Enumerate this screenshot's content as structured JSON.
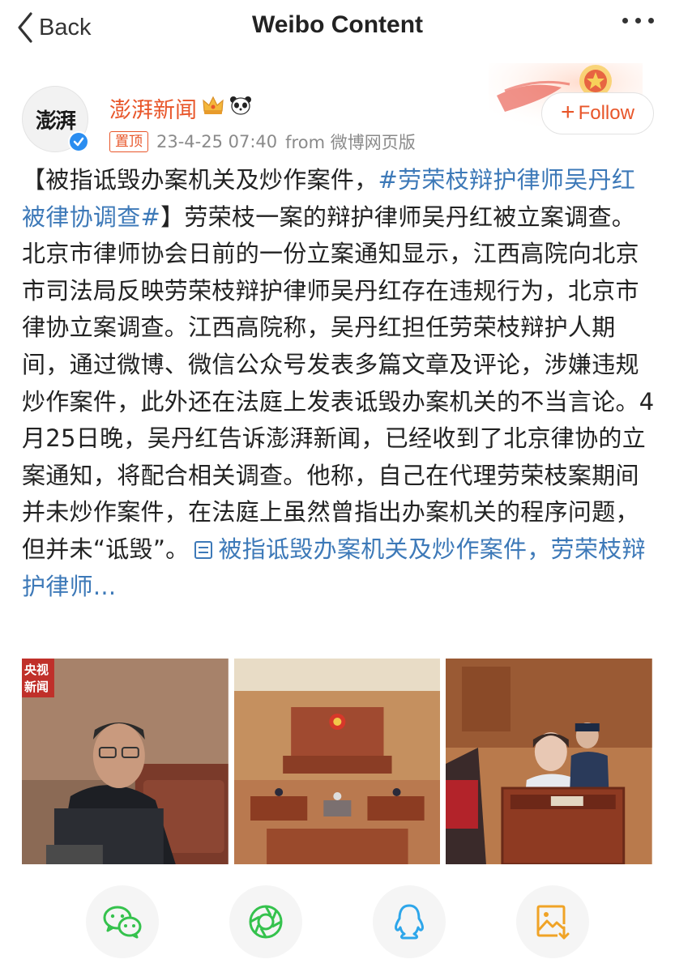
{
  "nav": {
    "back_label": "Back",
    "title": "Weibo Content"
  },
  "post": {
    "username": "澎湃新闻",
    "avatar_text": "澎湃",
    "pinned_badge": "置顶",
    "timestamp": "23-4-25 07:40",
    "source": "from 微博网页版",
    "follow_label": "Follow",
    "text_part1": "【被指诋毁办案机关及炒作案件，",
    "hashtag": "#劳荣枝辩护律师吴丹红被律协调查#",
    "text_part2": "】劳荣枝一案的辩护律师吴丹红被立案调查。北京市律师协会日前的一份立案通知显示，江西高院向北京市司法局反映劳荣枝辩护律师吴丹红存在违规行为，北京市律协立案调查。江西高院称，吴丹红担任劳荣枝辩护人期间，通过微博、微信公众号发表多篇文章及评论，涉嫌违规炒作案件，此外还在法庭上发表诋毁办案机关的不当言论。4月25日晚，吴丹红告诉澎湃新闻，已经收到了北京律协的立案通知，将配合相关调查。他称，自己在代理劳荣枝案期间并未炒作案件，在法庭上虽然曾指出办案机关的程序问题，但并未“诋毁”。",
    "article_link": "被指诋毁办案机关及炒作案件，劳荣枝辩护律师...",
    "images": [
      {
        "name": "cctv-lawyer-photo",
        "overlay": "央视\n新闻"
      },
      {
        "name": "courtroom-photo",
        "overlay": ""
      },
      {
        "name": "defendant-photo",
        "overlay": ""
      }
    ]
  },
  "share": [
    "wechat",
    "moments",
    "qq",
    "save-image"
  ],
  "colors": {
    "accent": "#e8562a",
    "link": "#3d79b8",
    "wechat_green": "#35c24d",
    "qq_blue": "#2da6ea",
    "save_orange": "#f0a326"
  }
}
